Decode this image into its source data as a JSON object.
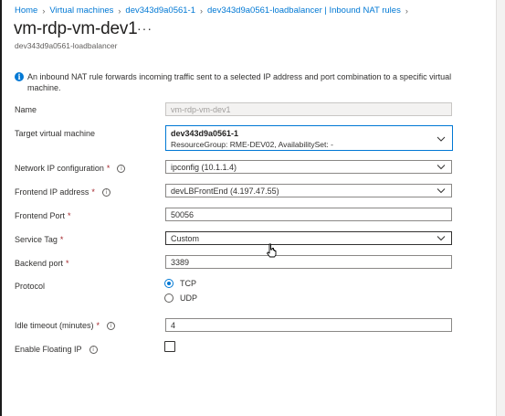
{
  "breadcrumb": [
    {
      "label": "Home"
    },
    {
      "label": "Virtual machines"
    },
    {
      "label": "dev343d9a0561-1"
    },
    {
      "label": "dev343d9a0561-loadbalancer | Inbound NAT rules"
    }
  ],
  "header": {
    "title": "vm-rdp-vm-dev1",
    "more": "···",
    "subtitle": "dev343d9a0561-loadbalancer"
  },
  "info": {
    "text": "An inbound NAT rule forwards incoming traffic sent to a selected IP address and port combination to a specific virtual machine."
  },
  "form": {
    "name": {
      "label": "Name",
      "value": "vm-rdp-vm-dev1"
    },
    "target_vm": {
      "label": "Target virtual machine",
      "value": "dev343d9a0561-1",
      "meta": "ResourceGroup: RME-DEV02, AvailabilitySet: -"
    },
    "network_ip": {
      "label": "Network IP configuration",
      "required": "*",
      "value": "ipconfig (10.1.1.4)"
    },
    "frontend_ip": {
      "label": "Frontend IP address",
      "required": "*",
      "value": "devLBFrontEnd (4.197.47.55)"
    },
    "frontend_port": {
      "label": "Frontend Port",
      "required": "*",
      "value": "50056"
    },
    "service_tag": {
      "label": "Service Tag",
      "required": "*",
      "value": "Custom"
    },
    "backend_port": {
      "label": "Backend port",
      "required": "*",
      "value": "3389"
    },
    "protocol": {
      "label": "Protocol",
      "options": [
        "TCP",
        "UDP"
      ],
      "selected": "TCP"
    },
    "idle_timeout": {
      "label": "Idle timeout (minutes)",
      "required": "*",
      "value": "4"
    },
    "floating_ip": {
      "label": "Enable Floating IP",
      "checked": false
    }
  },
  "colors": {
    "accent": "#0078d4",
    "required": "#a4262c"
  },
  "icons": {
    "info": "info-icon",
    "help": "help-circle-icon",
    "chevron": "chevron-down-icon"
  }
}
